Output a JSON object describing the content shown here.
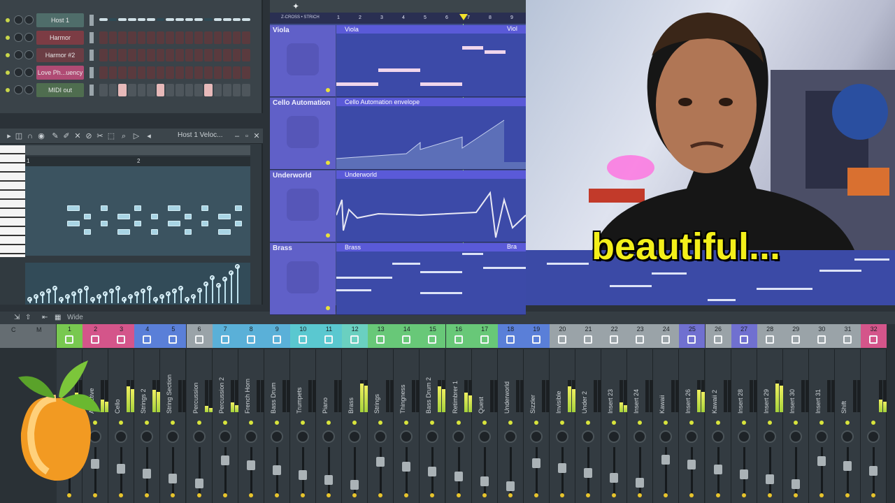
{
  "channel_rack": {
    "channels": [
      {
        "name": "Host 1",
        "color": "#4f6d6a"
      },
      {
        "name": "Harmor",
        "color": "#7c3c44"
      },
      {
        "name": "Harmor #2",
        "color": "#6b3d44"
      },
      {
        "name": "Love Ph...uency",
        "color": "#b04b74"
      },
      {
        "name": "MIDI out",
        "color": "#4f6d4f"
      }
    ]
  },
  "piano_roll": {
    "title": "Host 1  Veloc...",
    "bar_labels": [
      "1",
      "2"
    ]
  },
  "playlist": {
    "header_label": "Z-CROSS • STRICH",
    "bar_numbers": [
      "1",
      "2",
      "3",
      "4",
      "5",
      "6",
      "7",
      "8",
      "9"
    ],
    "tracks": [
      {
        "name": "Viola",
        "clip": "Viola",
        "clip_right": "Viol"
      },
      {
        "name": "Cello Automation",
        "clip": "Cello Automation envelope",
        "clip_right": ""
      },
      {
        "name": "Underworld",
        "clip": "Underworld",
        "clip_right": ""
      },
      {
        "name": "Brass",
        "clip": "Brass",
        "clip_right": "Bra"
      }
    ]
  },
  "overlay": {
    "caption": "beautiful..."
  },
  "mixer": {
    "toolbar_label": "Wide",
    "master_labels": [
      "C",
      "M"
    ],
    "inserts": [
      {
        "num": "1",
        "name": "",
        "color": "#78c850"
      },
      {
        "num": "2",
        "name": "Addictive",
        "color": "#d4558a"
      },
      {
        "num": "3",
        "name": "Cello",
        "color": "#d4558a"
      },
      {
        "num": "4",
        "name": "Strings 2",
        "color": "#5a7fd8"
      },
      {
        "num": "5",
        "name": "String Section",
        "color": "#5a7fd8"
      },
      {
        "num": "6",
        "name": "Percussion",
        "color": "#9aa3a8"
      },
      {
        "num": "7",
        "name": "Percussion 2",
        "color": "#5ab0d8"
      },
      {
        "num": "8",
        "name": "French Horn",
        "color": "#5ab0d8"
      },
      {
        "num": "9",
        "name": "Bass Drum",
        "color": "#5ab0d8"
      },
      {
        "num": "10",
        "name": "Trumpets",
        "color": "#5ac8d0"
      },
      {
        "num": "11",
        "name": "Piano",
        "color": "#5ac8d0"
      },
      {
        "num": "12",
        "name": "Brass",
        "color": "#6ad0c0"
      },
      {
        "num": "13",
        "name": "Strings",
        "color": "#68c878"
      },
      {
        "num": "14",
        "name": "Thingness",
        "color": "#68c878"
      },
      {
        "num": "15",
        "name": "Bass Drum 2",
        "color": "#68c878"
      },
      {
        "num": "16",
        "name": "Retimbrer 1",
        "color": "#68c878"
      },
      {
        "num": "17",
        "name": "Quest",
        "color": "#68c878"
      },
      {
        "num": "18",
        "name": "Underworld",
        "color": "#5a7fd8"
      },
      {
        "num": "19",
        "name": "Sizzler",
        "color": "#5a7fd8"
      },
      {
        "num": "20",
        "name": "Invisible",
        "color": "#9aa3a8"
      },
      {
        "num": "21",
        "name": "Under 2",
        "color": "#9aa3a8"
      },
      {
        "num": "22",
        "name": "Insert 23",
        "color": "#9aa3a8"
      },
      {
        "num": "23",
        "name": "Insert 24",
        "color": "#9aa3a8"
      },
      {
        "num": "24",
        "name": "Kawaii",
        "color": "#9aa3a8"
      },
      {
        "num": "25",
        "name": "Insert 26",
        "color": "#7070d0"
      },
      {
        "num": "26",
        "name": "Kawaii 2",
        "color": "#9aa3a8"
      },
      {
        "num": "27",
        "name": "Insert 28",
        "color": "#7070d0"
      },
      {
        "num": "28",
        "name": "Insert 29",
        "color": "#9aa3a8"
      },
      {
        "num": "29",
        "name": "Insert 30",
        "color": "#9aa3a8"
      },
      {
        "num": "30",
        "name": "Insert 31",
        "color": "#9aa3a8"
      },
      {
        "num": "31",
        "name": "Shift",
        "color": "#9aa3a8"
      },
      {
        "num": "32",
        "name": "",
        "color": "#d4558a"
      }
    ]
  }
}
